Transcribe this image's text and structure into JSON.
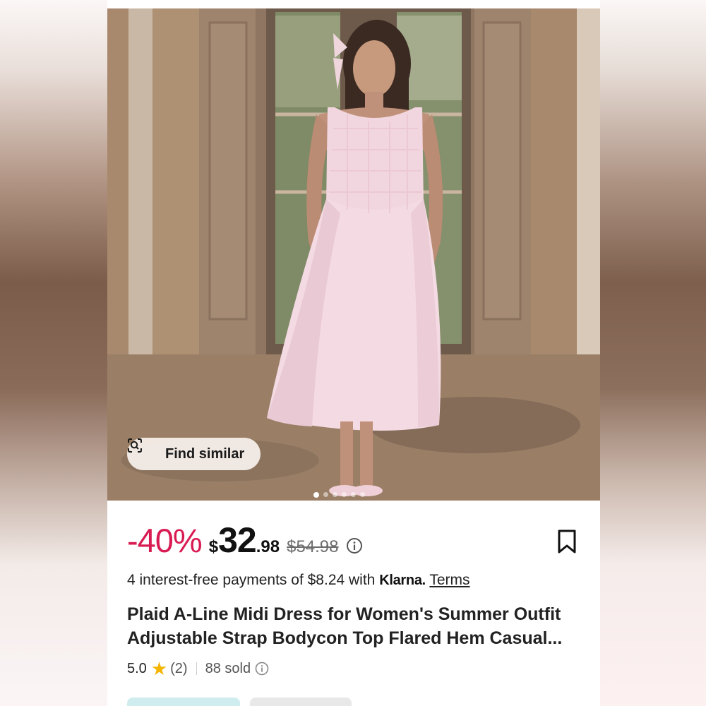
{
  "product": {
    "find_similar_label": "Find similar",
    "discount": "-40%",
    "price_currency": "$",
    "price_integer": "32",
    "price_cents": ".98",
    "original_price": "$54.98",
    "installments_text": "4 interest-free payments of $8.24 with",
    "klarna_brand": "Klarna.",
    "terms_link": "Terms",
    "title": "Plaid A-Line Midi Dress for Women's Summer Outfit Adjustable Strap Bodycon Top Flared Hem Casual...",
    "rating": "5.0",
    "rating_count": "(2)",
    "sold": "88 sold"
  },
  "gallery": {
    "image_count": 6,
    "active_index": 1
  },
  "icons": {
    "find_similar": "image-search-icon",
    "price_info": "info-icon",
    "bookmark": "bookmark-icon",
    "star": "star-icon",
    "sold_info": "info-icon"
  },
  "colors": {
    "discount": "#d81b52",
    "star": "#f5b400",
    "chip_primary": "#cfecef",
    "chip_secondary": "#e8e8e8"
  }
}
